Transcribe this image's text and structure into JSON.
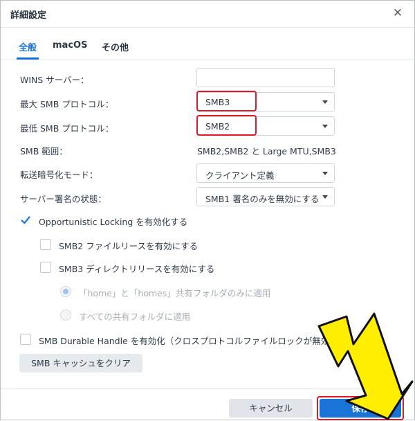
{
  "dialog": {
    "title": "詳細設定",
    "close_icon": "close-icon"
  },
  "tabs": [
    {
      "label": "全般",
      "active": true
    },
    {
      "label": "macOS",
      "active": false
    },
    {
      "label": "その他",
      "active": false
    }
  ],
  "fields": {
    "wins_label": "WINS サーバー：",
    "wins_value": "",
    "max_smb_label": "最大 SMB プロトコル：",
    "max_smb_value": "SMB3",
    "min_smb_label": "最低 SMB プロトコル：",
    "min_smb_value": "SMB2",
    "smb_range_label": "SMB 範囲：",
    "smb_range_value": "SMB2,SMB2 と Large MTU,SMB3",
    "transfer_encryption_label": "転送暗号化モード：",
    "transfer_encryption_value": "クライアント定義",
    "server_signing_label": "サーバー署名の状態：",
    "server_signing_value": "SMB1 署名のみを無効にする"
  },
  "options": {
    "opportunistic_locking": {
      "label": "Opportunistic Locking を有効化する",
      "checked": true
    },
    "smb2_lease": {
      "label": "SMB2 ファイルリースを有効にする",
      "checked": false
    },
    "smb3_directory_lease": {
      "label": "SMB3 ディレクトリリースを有効にする",
      "checked": false
    },
    "radio_home_only": {
      "label": "「home」と「homes」共有フォルダのみに適用",
      "selected": true
    },
    "radio_all_shares": {
      "label": "すべての共有フォルダに適用",
      "selected": false
    },
    "durable_handle": {
      "label": "SMB Durable Handle を有効化（クロスプロトコルファイルロックが無効化されます）",
      "checked": false
    }
  },
  "buttons": {
    "clear_cache": "SMB キャッシュをクリア",
    "cancel": "キャンセル",
    "save": "保存"
  },
  "colors": {
    "accent": "#1a73d6",
    "highlight": "#e0162b",
    "annotation_arrow": "#ffee00"
  }
}
